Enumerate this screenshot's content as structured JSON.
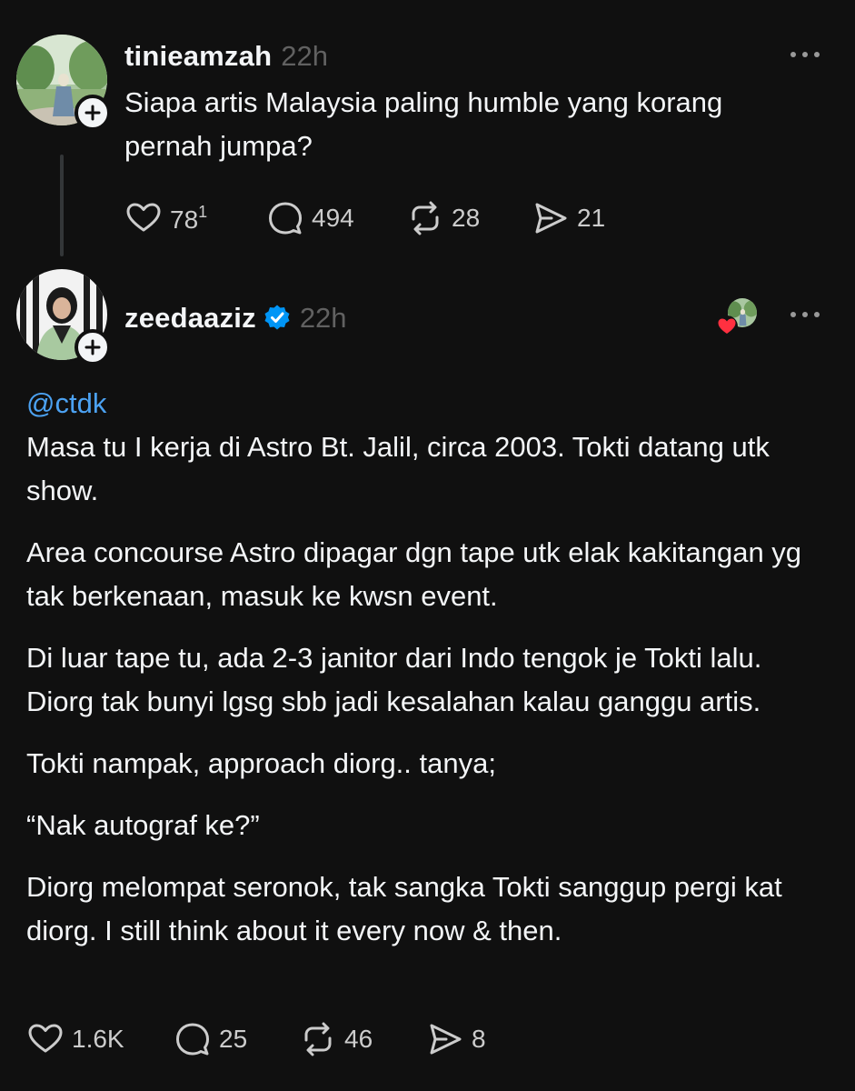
{
  "original_post": {
    "username": "tinieamzah",
    "time": "22h",
    "text_lines": [
      "Siapa artis Malaysia paling humble yang korang",
      "pernah jumpa?"
    ],
    "likes": "78",
    "likes_sup": "1",
    "replies": "494",
    "reposts": "28",
    "shares": "21"
  },
  "reply_post": {
    "username": "zeedaaziz",
    "time": "22h",
    "mention": "@ctdk",
    "paragraphs": [
      "Masa tu I kerja di Astro Bt. Jalil, circa 2003. Tokti datang utk show.",
      "Area concourse Astro dipagar dgn tape utk elak kakitangan yg tak berkenaan, masuk ke kwsn event.",
      "Di luar tape tu, ada 2-3 janitor dari Indo tengok je Tokti lalu. Diorg tak bunyi lgsg sbb jadi kesalahan kalau ganggu artis.",
      "Tokti nampak, approach diorg.. tanya;",
      "“Nak autograf ke?”",
      "Diorg melompat seronok, tak sangka Tokti sanggup pergi kat diorg. I still think about it every now & then."
    ],
    "likes": "1.6K",
    "replies": "25",
    "reposts": "46",
    "shares": "8"
  },
  "icons": {
    "like": "heart-icon",
    "reply": "comment-icon",
    "repost": "repost-icon",
    "share": "send-icon",
    "more": "more-dots-icon",
    "follow": "plus-icon",
    "verified": "verified-badge-icon"
  },
  "colors": {
    "background": "#101010",
    "text": "#f3f5f7",
    "muted": "#616161",
    "mention": "#4ca2f2",
    "verified": "#0095f6",
    "heart_badge": "#ff3040"
  }
}
